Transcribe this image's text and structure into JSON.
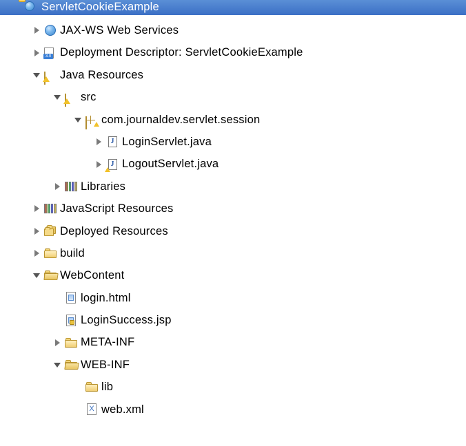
{
  "titleBar": {
    "projectName": "ServletCookieExample"
  },
  "tree": {
    "jaxws": "JAX-WS Web Services",
    "deploymentDescriptor": "Deployment Descriptor: ServletCookieExample",
    "javaResources": "Java Resources",
    "src": "src",
    "package": "com.journaldev.servlet.session",
    "loginServlet": "LoginServlet.java",
    "logoutServlet": "LogoutServlet.java",
    "libraries": "Libraries",
    "jsResources": "JavaScript Resources",
    "deployedResources": "Deployed Resources",
    "build": "build",
    "webContent": "WebContent",
    "loginHtml": "login.html",
    "loginSuccessJsp": "LoginSuccess.jsp",
    "metaInf": "META-INF",
    "webInf": "WEB-INF",
    "lib": "lib",
    "webXml": "web.xml"
  }
}
